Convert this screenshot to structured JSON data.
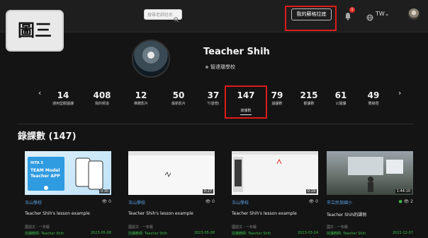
{
  "header": {
    "search_placeholder": "搜尋老師姓名",
    "forum_button": "我的蘇格拉底",
    "notification_count": "1",
    "language": "TW",
    "language_caret": "⌄"
  },
  "figure_label": "圖三",
  "profile": {
    "name": "Teacher Shih",
    "school": "智達環學校"
  },
  "nav": {
    "prev": "‹",
    "next": "›"
  },
  "stats": [
    {
      "num": "14",
      "label": "通用型觀議課"
    },
    {
      "num": "408",
      "label": "我的頻道"
    },
    {
      "num": "12",
      "label": "推薦影片"
    },
    {
      "num": "50",
      "label": "最新影片"
    },
    {
      "num": "37",
      "label": "T(發燈)"
    },
    {
      "num": "147",
      "label": "錄課數"
    },
    {
      "num": "79",
      "label": "議課數"
    },
    {
      "num": "215",
      "label": "觀課數"
    },
    {
      "num": "61",
      "label": "公開課"
    },
    {
      "num": "49",
      "label": "雙線燈"
    }
  ],
  "section": {
    "title": "錄課數 (147)"
  },
  "cards": [
    {
      "duration": "0:30",
      "school": "玉山學校",
      "views": "0",
      "title": "Teacher Shih's lesson example",
      "meta": "國語文 - 一年級",
      "teacher": "授課教師: Teacher Shih",
      "date": "2023-05-08"
    },
    {
      "duration": "0:27",
      "school": "玉山學校",
      "views": "0",
      "title": "Teacher Shih's lesson example",
      "meta": "國語文 - 一年級",
      "teacher": "授課教師: Teacher Shih",
      "date": "2023-05-08"
    },
    {
      "duration": "0:19",
      "school": "玉山學校",
      "views": "0",
      "title": "Teacher Shih's lesson example",
      "meta": "國語文 - 一年級",
      "teacher": "授課教師: Teacher Shih",
      "date": "2023-03-24"
    },
    {
      "duration": "1:44:10",
      "school": "市立民族國小",
      "views": "2",
      "title": "Teacher Shih的課例",
      "meta": "國文 - 一年級",
      "teacher": "授課教師: Teacher Shih",
      "date": "2022-12-07"
    }
  ],
  "thumb_text": {
    "app_brand": "HiTA 5",
    "app_title1": "TEAM Model",
    "app_title2": "Teacher APP"
  }
}
